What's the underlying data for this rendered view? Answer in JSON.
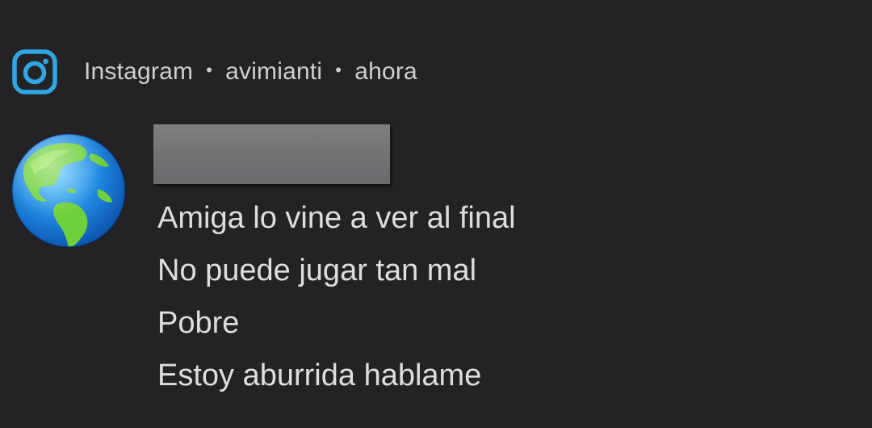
{
  "notification": {
    "app_icon": "instagram-icon",
    "app_name": "Instagram",
    "separator": "•",
    "account": "avimianti",
    "time": "ahora",
    "avatar": "globe-americas-icon",
    "sender_name_redacted": true,
    "messages": [
      "Amiga lo vine a ver al final",
      "No puede jugar tan mal",
      "Pobre",
      "Estoy aburrida hablame"
    ]
  },
  "colors": {
    "background": "#232325",
    "text": "#dedede",
    "meta_text": "#cfcfcf",
    "instagram_icon": "#2fa7e3",
    "redaction_box": "#77777a"
  }
}
